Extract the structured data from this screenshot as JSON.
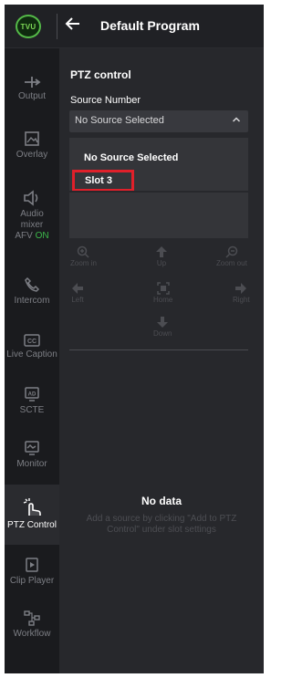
{
  "header": {
    "logo_text": "TVU",
    "back_icon": "arrow-left-icon",
    "title": "Default Program"
  },
  "sidebar": {
    "items": [
      {
        "label": "Output",
        "icon": "output-icon"
      },
      {
        "label": "Overlay",
        "icon": "overlay-icon"
      },
      {
        "label_lines": [
          "Audio",
          "mixer"
        ],
        "afv_label": "AFV",
        "afv_state": "ON",
        "icon": "speaker-icon"
      },
      {
        "label": "Intercom",
        "icon": "phone-icon"
      },
      {
        "label": "Live Caption",
        "icon": "cc-icon"
      },
      {
        "label": "SCTE",
        "icon": "ad-icon"
      },
      {
        "label": "Monitor",
        "icon": "monitor-icon"
      },
      {
        "label": "PTZ Control",
        "icon": "ptz-icon",
        "active": true
      },
      {
        "label": "Clip Player",
        "icon": "clip-icon"
      },
      {
        "label": "Workflow",
        "icon": "workflow-icon"
      }
    ],
    "colors": {
      "active_text": "#ffffff",
      "inactive_text": "#7d7f85",
      "afv_on": "#3cb84a"
    }
  },
  "panel": {
    "title": "PTZ control",
    "source_label": "Source Number",
    "select_value": "No Source Selected",
    "options": [
      "No Source Selected",
      "Slot 3"
    ],
    "highlight_color": "#e0202a",
    "controls": {
      "zoom_in": "Zoom in",
      "up": "Up",
      "zoom_out": "Zoom out",
      "left": "Left",
      "home": "Home",
      "right": "Right",
      "down": "Down"
    },
    "empty": {
      "title": "No data",
      "description": "Add a source by clicking \"Add to PTZ Control\" under slot settings"
    }
  }
}
